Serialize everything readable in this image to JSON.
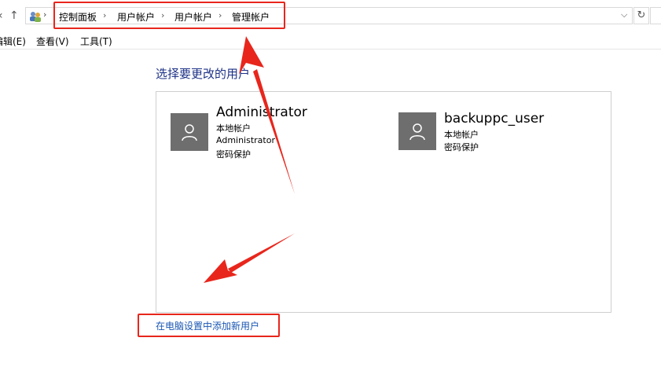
{
  "address_bar": {
    "breadcrumbs": [
      "控制面板",
      "用户帐户",
      "用户帐户",
      "管理帐户"
    ],
    "back_icon": "back-arrow-icon",
    "up_icon": "up-arrow-icon",
    "location_icon": "users-control-panel-icon",
    "dropdown_icon": "chevron-down-icon",
    "refresh_icon": "refresh-icon"
  },
  "menu": {
    "items": [
      "编辑(E)",
      "查看(V)",
      "工具(T)"
    ]
  },
  "main": {
    "title": "选择要更改的用户",
    "users": [
      {
        "name": "Administrator",
        "lines": [
          "本地帐户",
          "Administrator",
          "密码保护"
        ]
      },
      {
        "name": "backuppc_user",
        "lines": [
          "本地帐户",
          "密码保护"
        ]
      }
    ],
    "add_user_link": "在电脑设置中添加新用户"
  },
  "annotation_color": "#e8261c"
}
